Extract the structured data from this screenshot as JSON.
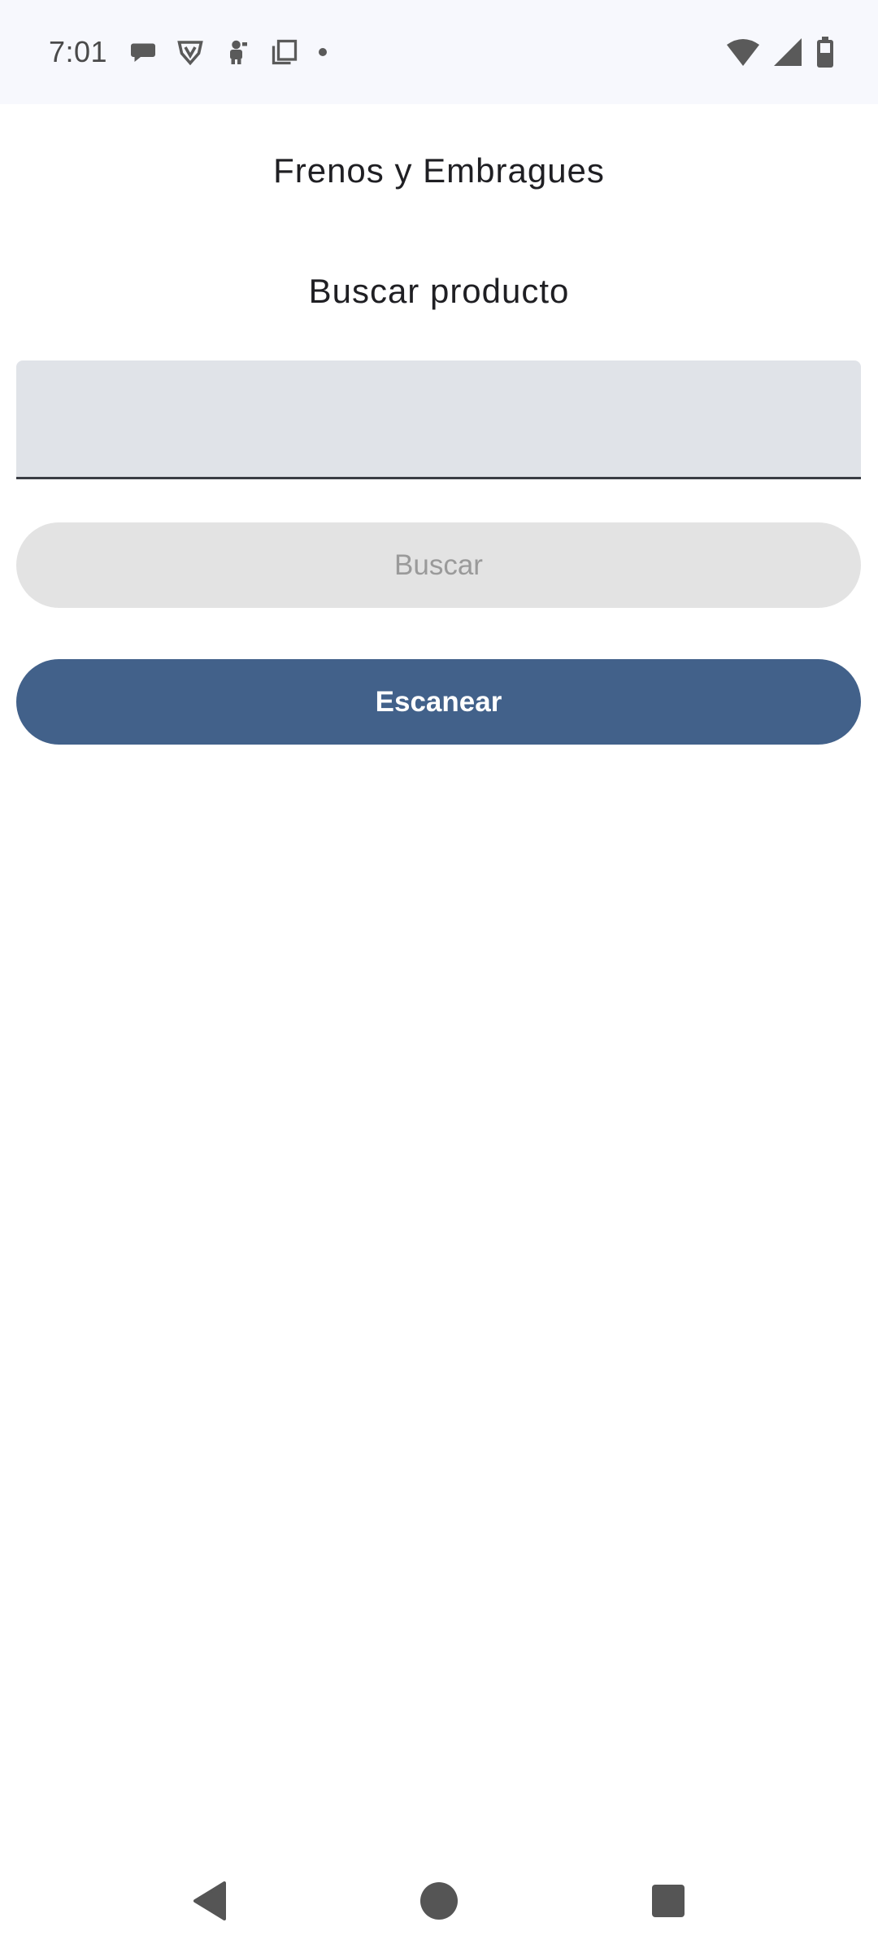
{
  "status_bar": {
    "time": "7:01",
    "left_icons": [
      "chat-bubble-icon",
      "shield-v-icon",
      "robot-icon",
      "copy-icon",
      "dot-icon"
    ],
    "right_icons": [
      "wifi-icon",
      "signal-icon",
      "battery-icon"
    ]
  },
  "app": {
    "title": "Frenos y Embragues",
    "section_title": "Buscar producto"
  },
  "search": {
    "value": "",
    "placeholder": ""
  },
  "buttons": {
    "search_label": "Buscar",
    "scan_label": "Escanear"
  },
  "colors": {
    "status_bar_bg": "#f7f8fd",
    "field_bg": "#e0e3e8",
    "disabled_button_bg": "#e3e3e3",
    "disabled_button_text": "#9a9a9a",
    "primary": "#42618a"
  },
  "nav_bar": {
    "icons": [
      "back-icon",
      "home-icon",
      "recents-icon"
    ]
  }
}
